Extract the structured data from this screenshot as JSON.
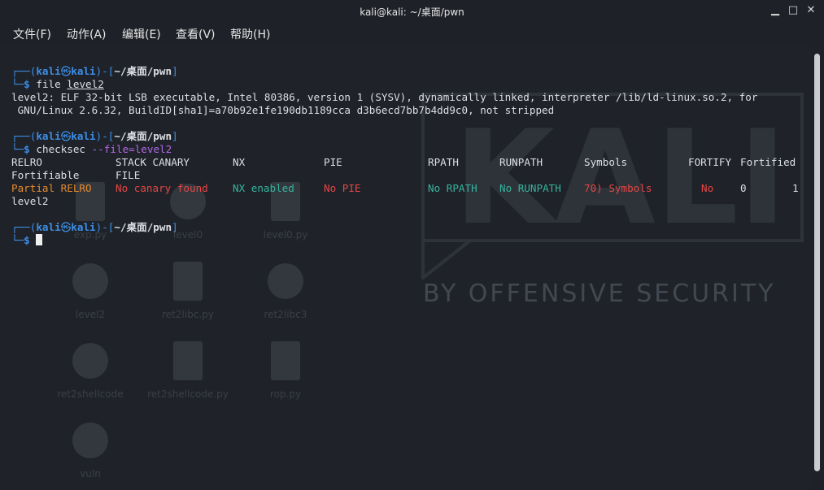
{
  "window": {
    "title": "kali@kali: ~/桌面/pwn",
    "min_label": "▁",
    "max_label": "□",
    "close_label": "✕"
  },
  "menubar": {
    "items": [
      "文件(F)",
      "动作(A)",
      "编辑(E)",
      "查看(V)",
      "帮助(H)"
    ]
  },
  "prompt": {
    "corner_top": "┌──(",
    "user": "kali",
    "at": "㉿",
    "host": "kali",
    "mid": ")-[",
    "path": "~/桌面/pwn",
    "end": "]",
    "corner_bottom": "└─",
    "dollar": "$"
  },
  "commands": {
    "file_cmd": "file",
    "file_arg": "level2",
    "checksec_cmd": "checksec",
    "checksec_arg": "--file=level2"
  },
  "file_output": {
    "line1": "level2: ELF 32-bit LSB executable, Intel 80386, version 1 (SYSV), dynamically linked, interpreter /lib/ld-linux.so.2, for",
    "line2": " GNU/Linux 2.6.32, BuildID[sha1]=a70b92e1fe190db1189cca d3b6ecd7bb7b4dd9c0, not stripped"
  },
  "checksec": {
    "headers": [
      "RELRO",
      "STACK CANARY",
      "NX",
      "PIE",
      "RPATH",
      "RUNPATH",
      "Symbols",
      "FORTIFY",
      "Fortified"
    ],
    "headers2": [
      "Fortifiable",
      "FILE"
    ],
    "values": [
      "Partial RELRO",
      "No canary found",
      "NX enabled",
      "No PIE",
      "No RPATH",
      "No RUNPATH",
      "70) Symbols",
      "No",
      "0",
      "1"
    ],
    "file": "level2"
  },
  "desktop_icons": [
    "exp.py",
    "level0",
    "level0.py",
    "level2",
    "ret2libc.py",
    "ret2libc3",
    "ret2shellcode",
    "ret2shellcode.py",
    "rop.py",
    "vuln"
  ],
  "wallpaper": {
    "logo_text": "KALI",
    "tagline": "BY OFFENSIVE SECURITY"
  },
  "colors": {
    "blue": "#3d8ee6",
    "purple": "#b267e6",
    "red": "#e64545",
    "orange": "#e68a2e",
    "green": "#36b39e"
  }
}
